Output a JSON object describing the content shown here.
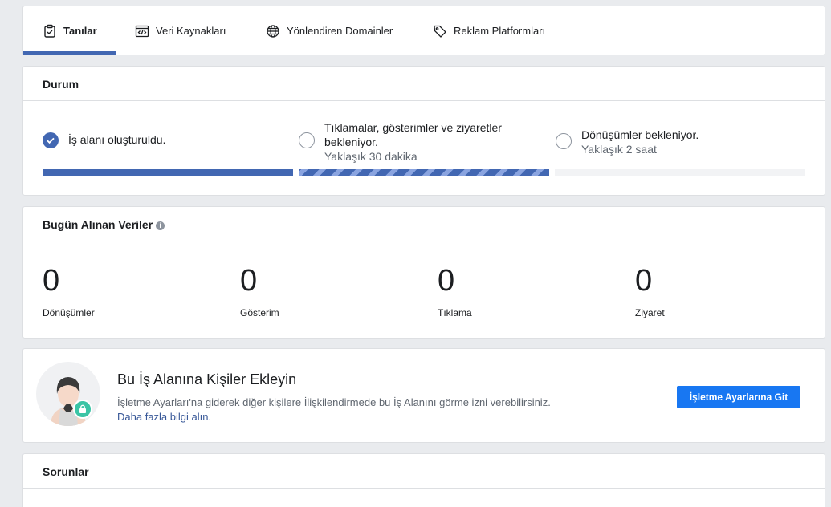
{
  "tabs": [
    {
      "label": "Tanılar",
      "icon": "clipboard-check-icon",
      "active": true
    },
    {
      "label": "Veri Kaynakları",
      "icon": "code-window-icon"
    },
    {
      "label": "Yönlendiren Domainler",
      "icon": "globe-icon"
    },
    {
      "label": "Reklam Platformları",
      "icon": "tag-icon"
    }
  ],
  "status": {
    "title": "Durum",
    "steps": [
      {
        "text": "İş alanı oluşturuldu.",
        "state": "done"
      },
      {
        "text_line1": "Tıklamalar, gösterimler ve ziyaretler",
        "text_line2": "bekleniyor.",
        "sub": "Yaklaşık 30 dakika",
        "state": "in-progress"
      },
      {
        "text": "Dönüşümler bekleniyor.",
        "sub": "Yaklaşık 2 saat",
        "state": "pending"
      }
    ]
  },
  "today": {
    "title": "Bugün Alınan Veriler",
    "info_icon": "info-icon",
    "stats": [
      {
        "value": "0",
        "label": "Dönüşümler"
      },
      {
        "value": "0",
        "label": "Gösterim"
      },
      {
        "value": "0",
        "label": "Tıklama"
      },
      {
        "value": "0",
        "label": "Ziyaret"
      }
    ]
  },
  "people": {
    "title": "Bu İş Alanına Kişiler Ekleyin",
    "description": "İşletme Ayarları'na giderek diğer kişilere İlişkilendirmede bu İş Alanını görme izni verebilirsiniz.",
    "link": "Daha fazla bilgi alın.",
    "button": "İşletme Ayarlarına Git"
  },
  "issues": {
    "title": "Sorunlar"
  },
  "colors": {
    "accent": "#4267b2",
    "button": "#1877f2",
    "lock_badge": "#3bc4a5",
    "link": "#385898"
  }
}
